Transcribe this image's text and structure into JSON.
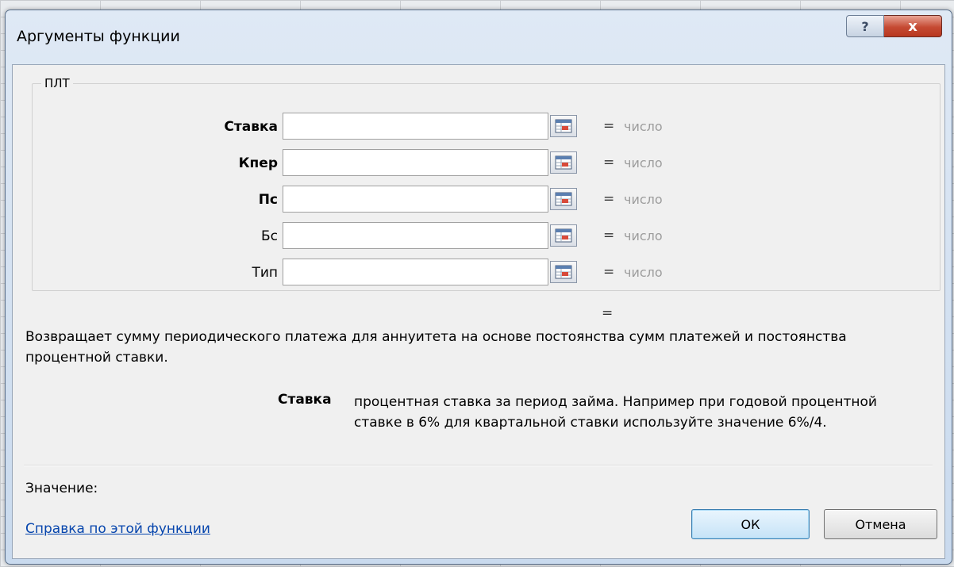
{
  "dialog": {
    "title": "Аргументы функции",
    "help_button": "?",
    "close_button": "x"
  },
  "function": {
    "name": "ПЛТ",
    "arguments": [
      {
        "label": "Ставка",
        "required": true,
        "value": "",
        "result": "число"
      },
      {
        "label": "Кпер",
        "required": true,
        "value": "",
        "result": "число"
      },
      {
        "label": "Пс",
        "required": true,
        "value": "",
        "result": "число"
      },
      {
        "label": "Бс",
        "required": false,
        "value": "",
        "result": "число"
      },
      {
        "label": "Тип",
        "required": false,
        "value": "",
        "result": "число"
      }
    ],
    "equals_sign": "=",
    "formula_result_eq": "=",
    "description": "Возвращает сумму периодического платежа для аннуитета на основе постоянства сумм платежей и постоянства процентной ставки.",
    "current_param": {
      "name": "Ставка",
      "description": "процентная ставка за период займа. Например при годовой процентной ставке в 6% для квартальной ставки используйте значение 6%/4."
    }
  },
  "footer": {
    "value_label": "Значение:",
    "help_link": "Справка по этой функции",
    "ok_label": "ОК",
    "cancel_label": "Отмена"
  },
  "colors": {
    "result_text": "#9d9d9d",
    "link": "#0645ad",
    "close_button": "#c54a33"
  }
}
